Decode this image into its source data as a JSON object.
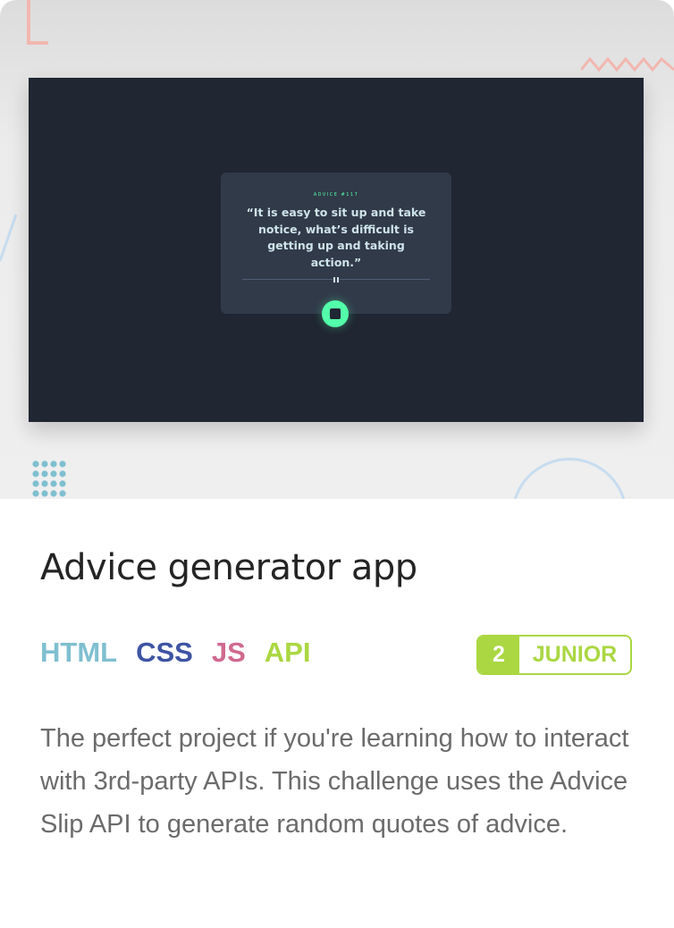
{
  "hero": {
    "advice": {
      "number": "ADVICE #117",
      "quote": "“It is easy to sit up and take notice, what’s difficult is getting up and taking action.”",
      "accent_color": "#53ffaa"
    }
  },
  "challenge": {
    "title": "Advice generator app",
    "tags": [
      {
        "label": "HTML",
        "color": "#7fbfd0"
      },
      {
        "label": "CSS",
        "color": "#3e54a3"
      },
      {
        "label": "JS",
        "color": "#d06a8f"
      },
      {
        "label": "API",
        "color": "#aad742"
      }
    ],
    "difficulty": {
      "level": "2",
      "label": "JUNIOR",
      "color": "#aad742"
    },
    "description": "The perfect project if you're learning how to interact with 3rd-party APIs. This challenge uses the Advice Slip API to generate random quotes of advice."
  },
  "icons": [
    "pause-icon",
    "dice-icon"
  ]
}
